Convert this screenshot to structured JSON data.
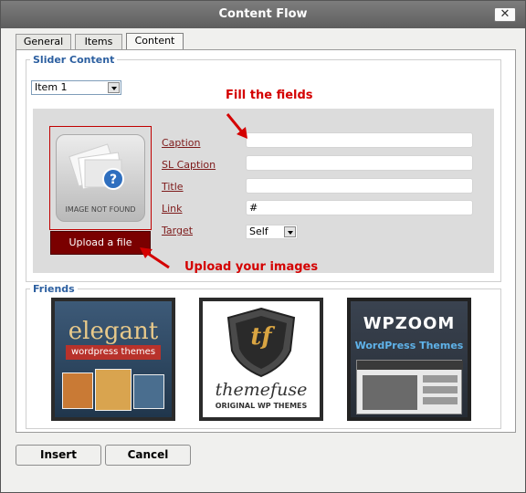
{
  "window": {
    "title": "Content Flow",
    "close_glyph": "✕"
  },
  "tabs": [
    {
      "label": "General",
      "active": false
    },
    {
      "label": "Items",
      "active": false
    },
    {
      "label": "Content",
      "active": true
    }
  ],
  "slider_content": {
    "legend": "Slider Content",
    "item_select": {
      "value": "Item 1"
    },
    "image_placeholder_text": "IMAGE NOT FOUND",
    "upload_label": "Upload a file",
    "fields": [
      {
        "label": "Caption",
        "value": ""
      },
      {
        "label": "SL Caption",
        "value": ""
      },
      {
        "label": "Title",
        "value": ""
      },
      {
        "label": "Link",
        "value": "#"
      }
    ],
    "target": {
      "label": "Target",
      "value": "Self"
    }
  },
  "annotations": {
    "fill_fields": "Fill the fields",
    "upload_images": "Upload your images"
  },
  "friends": {
    "legend": "Friends",
    "items": [
      {
        "name": "elegant",
        "tagline": "wordpress themes"
      },
      {
        "name": "themefuse",
        "mark": "tf",
        "tagline": "ORIGINAL WP THEMES"
      },
      {
        "name": "WPZOOM",
        "tagline": "WordPress Themes"
      }
    ]
  },
  "buttons": {
    "insert": "Insert",
    "cancel": "Cancel"
  },
  "colors": {
    "accent_red": "#d40000",
    "upload_bg": "#7a0000",
    "legend_blue": "#2c5fa0"
  }
}
